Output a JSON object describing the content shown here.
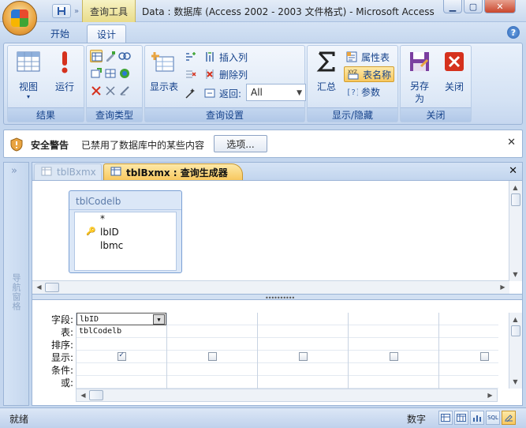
{
  "window": {
    "title": "Data : 数据库 (Access 2002 - 2003 文件格式) - Microsoft Access",
    "context_tab": "查询工具",
    "buttons": [
      "minimize",
      "maximize",
      "close"
    ]
  },
  "ribbon": {
    "tabs": [
      {
        "label": "开始",
        "active": false
      },
      {
        "label": "设计",
        "active": true
      }
    ],
    "groups": {
      "results": {
        "label": "结果",
        "view": "视图",
        "run": "运行"
      },
      "query_type": {
        "label": "查询类型"
      },
      "query_setup": {
        "label": "查询设置",
        "show_table": "显示表",
        "insert_column": "插入列",
        "delete_column": "删除列",
        "returns_label": "返回:",
        "returns_value": "All"
      },
      "show_hide": {
        "label": "显示/隐藏",
        "totals": "汇总",
        "property_sheet": "属性表",
        "table_names": "表名称",
        "parameters": "参数"
      },
      "close": {
        "label": "关闭",
        "save_as": "另存为",
        "close": "关闭"
      }
    }
  },
  "security_bar": {
    "title": "安全警告",
    "message": "已禁用了数据库中的某些内容",
    "options_button": "选项..."
  },
  "nav_pane": {
    "label": "导航窗格",
    "toggle": "»"
  },
  "doc_tabs": [
    {
      "label": "tblBxmx",
      "active": false
    },
    {
      "label": "tblBxmx : 查询生成器",
      "active": true
    }
  ],
  "table_box": {
    "name": "tblCodelb",
    "fields": [
      "*",
      "lbID",
      "lbmc"
    ],
    "key_field": "lbID"
  },
  "grid": {
    "row_labels": [
      "字段:",
      "表:",
      "排序:",
      "显示:",
      "条件:",
      "或:"
    ],
    "columns": [
      {
        "field": "lbID",
        "table": "tblCodelb",
        "show": true
      },
      {
        "field": "",
        "table": "",
        "show": false
      },
      {
        "field": "",
        "table": "",
        "show": false
      },
      {
        "field": "",
        "table": "",
        "show": false
      },
      {
        "field": "",
        "table": "",
        "show": false
      }
    ]
  },
  "status_bar": {
    "ready": "就绪",
    "num": "数字",
    "sql": "SQL"
  },
  "colors": {
    "ribbon_bg": "#d4e2f4",
    "accent": "#f8c85f",
    "text": "#15428b"
  }
}
